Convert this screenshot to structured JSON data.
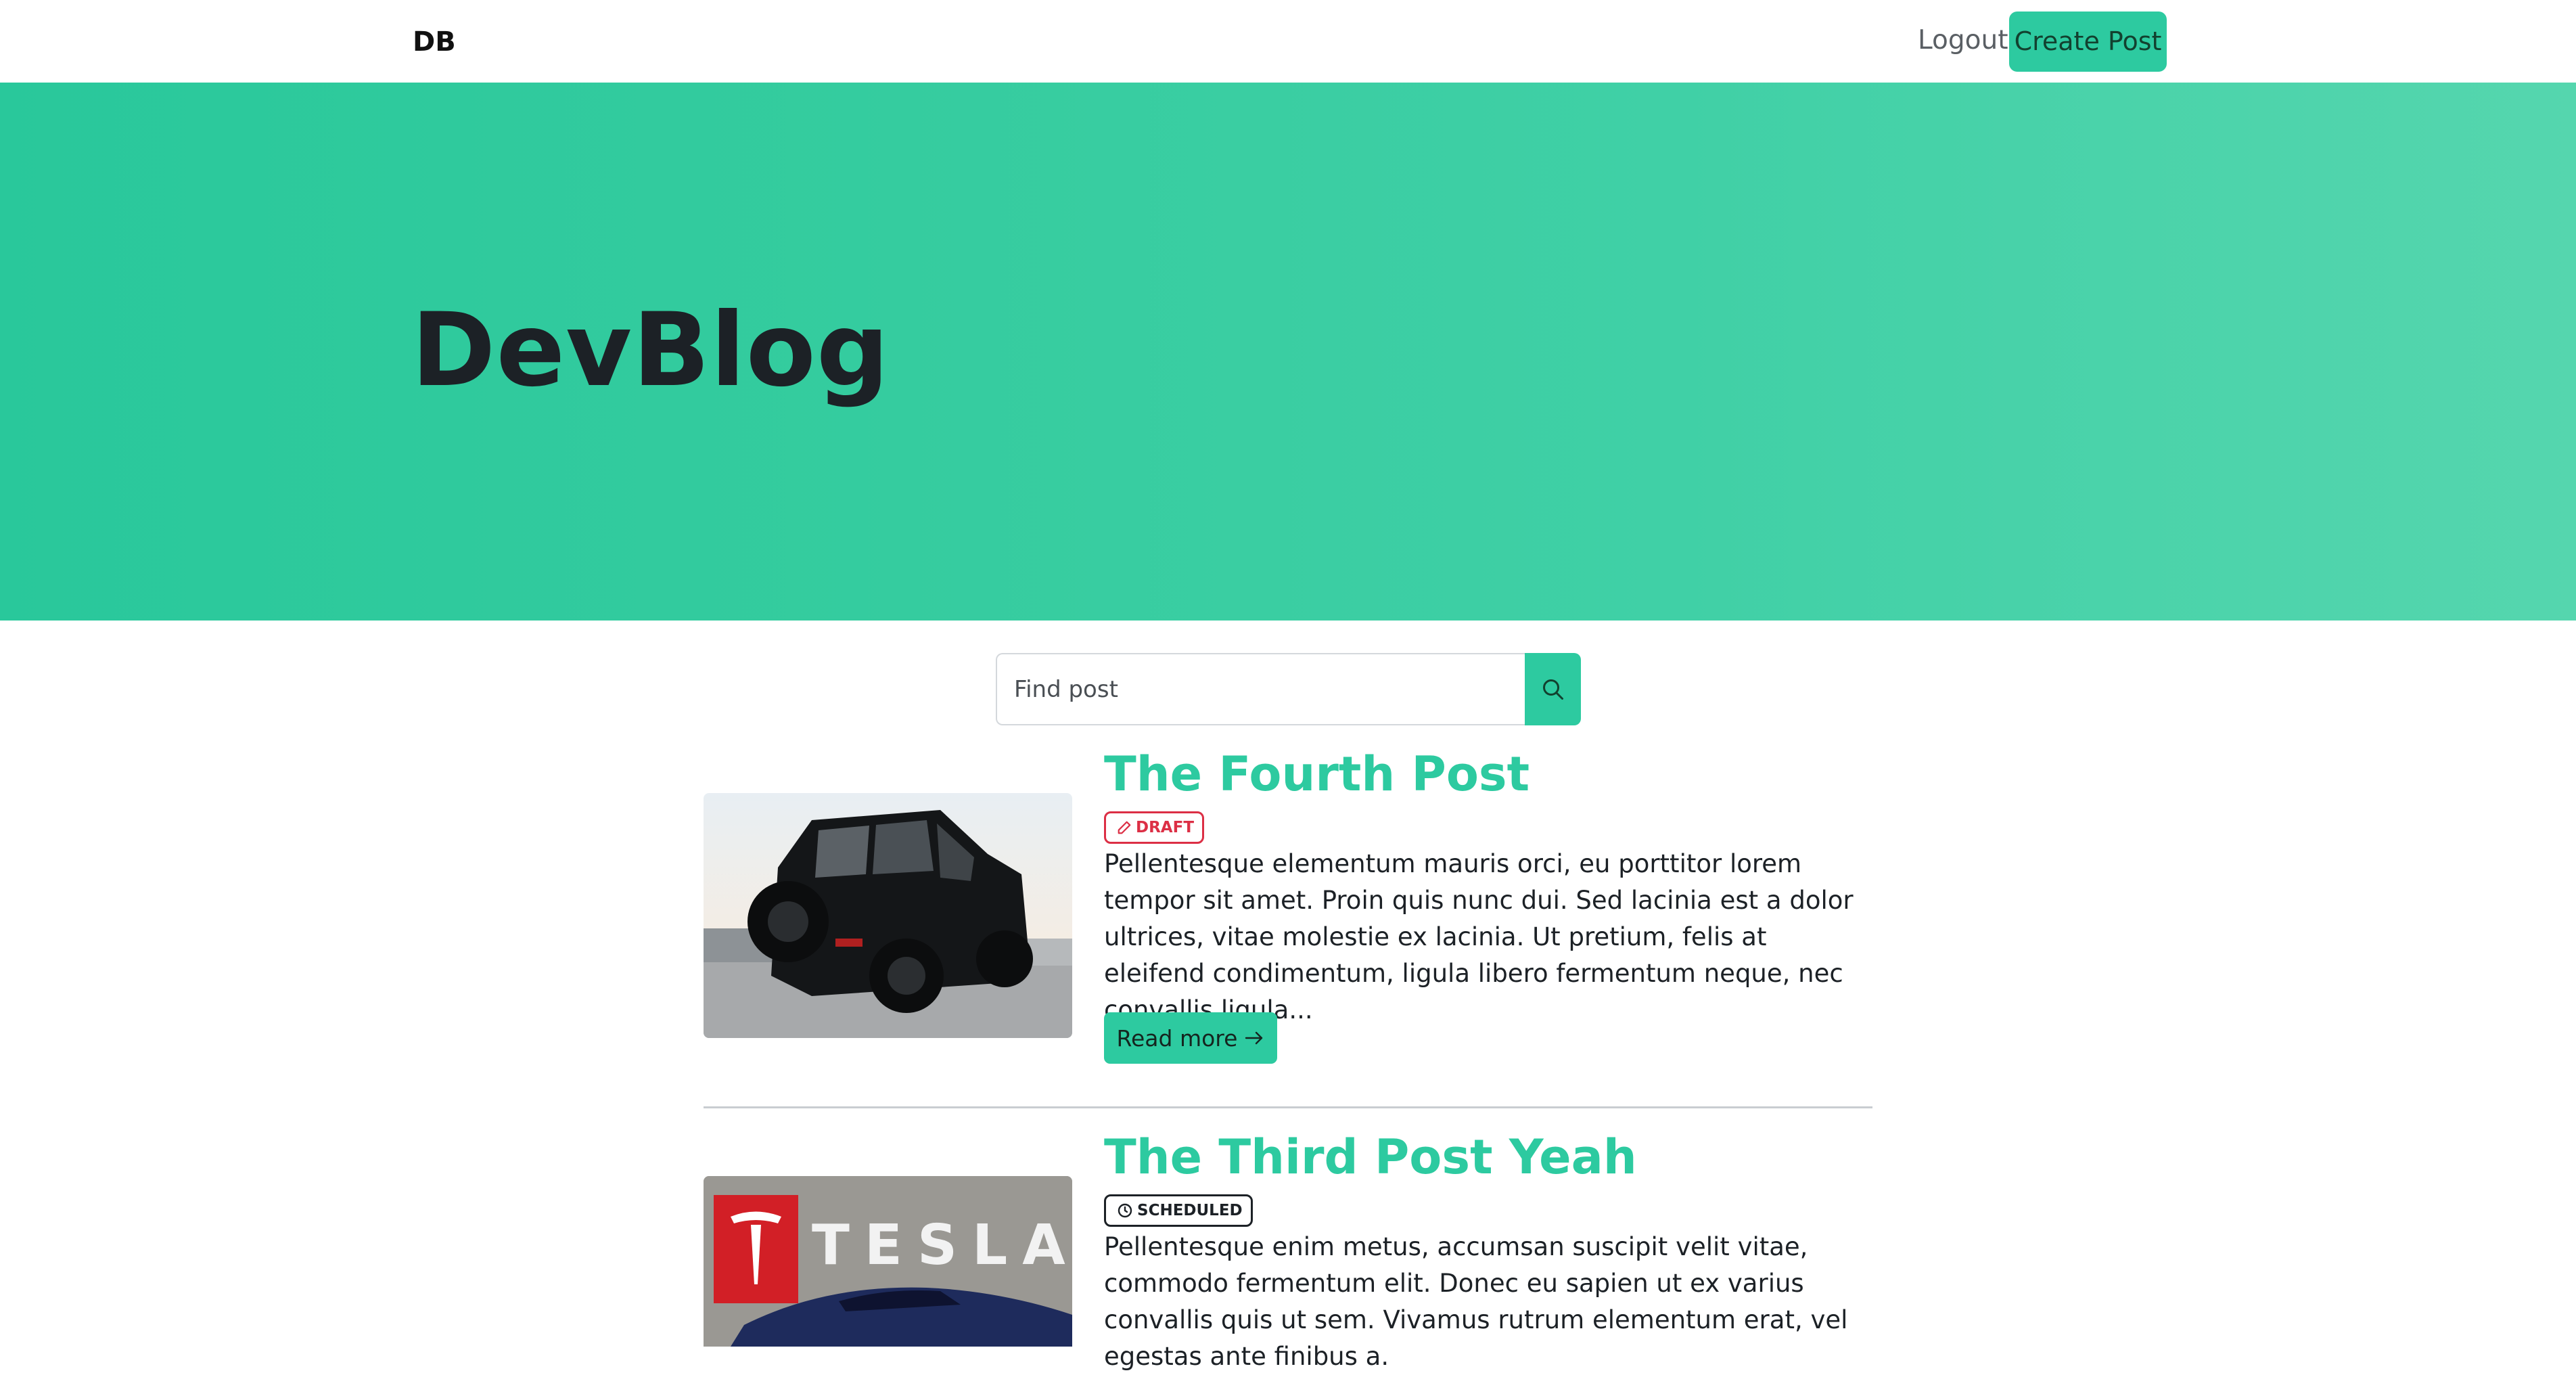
{
  "navbar": {
    "brand": "DB",
    "logout_label": "Logout",
    "create_label": "Create Post"
  },
  "hero": {
    "title": "DevBlog",
    "gradient_start": "#29c89b",
    "gradient_end": "#55d6ae"
  },
  "search": {
    "placeholder": "Find post",
    "value": "",
    "icon": "search-icon"
  },
  "posts": [
    {
      "title": "The Fourth Post",
      "status": "DRAFT",
      "status_icon": "pencil-icon",
      "status_color": "#dc2f45",
      "excerpt": "Pellentesque elementum mauris orci, eu porttitor lorem tempor sit amet. Proin quis nunc dui. Sed lacinia est a dolor ultrices, vitae molestie ex lacinia. Ut pretium, felis at eleifend condimentum, ligula libero fermentum neque, nec convallis ligula...",
      "read_more_label": "Read more",
      "image": "black-suv-photo"
    },
    {
      "title": "The Third Post Yeah",
      "status": "SCHEDULED",
      "status_icon": "clock-icon",
      "status_color": "#1c2126",
      "excerpt": "Pellentesque enim metus, accumsan suscipit velit vitae, commodo fermentum elit. Donec eu sapien ut ex varius convallis quis ut sem. Vivamus rutrum elementum erat, vel egestas ante finibus a.",
      "image": "tesla-showroom-photo"
    }
  ],
  "colors": {
    "accent": "#2dcaa0",
    "draft": "#dc2f45",
    "text": "#1c2126"
  }
}
